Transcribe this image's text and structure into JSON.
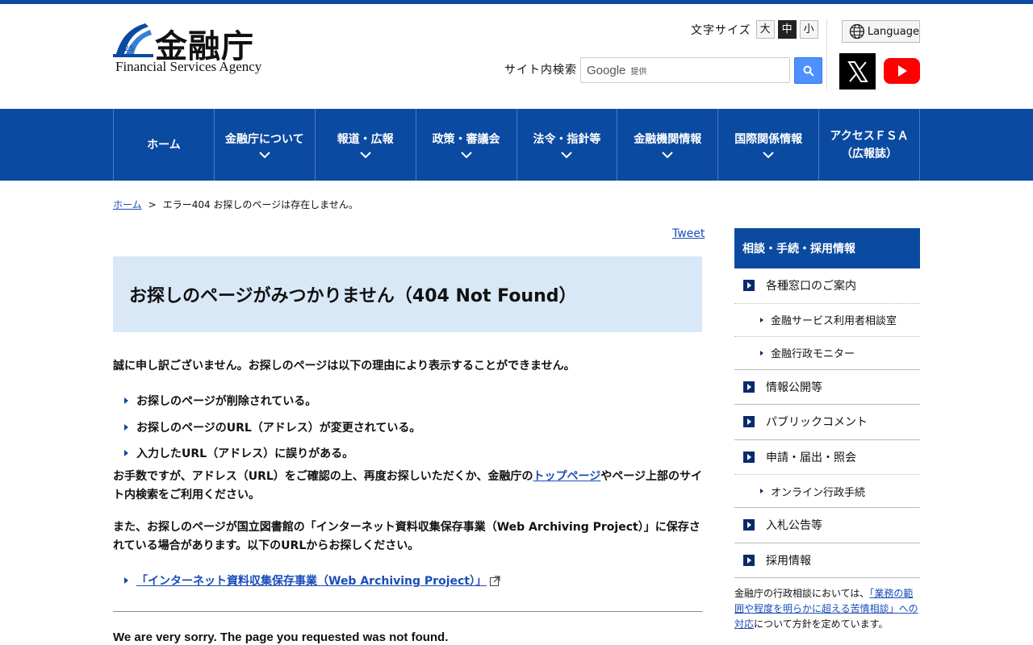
{
  "header": {
    "logo_kanji": "金融庁",
    "logo_en": "Financial Services Agency",
    "font_size_label": "文字サイズ",
    "font_sizes": [
      "大",
      "中",
      "小"
    ],
    "language_label": "Language",
    "search_label": "サイト内検索",
    "search_brand": "Google",
    "search_provided": "提供"
  },
  "nav": {
    "items": [
      {
        "label": "ホーム"
      },
      {
        "label": "金融庁について"
      },
      {
        "label": "報道・広報"
      },
      {
        "label": "政策・審議会"
      },
      {
        "label": "法令・指針等"
      },
      {
        "label": "金融機関情報"
      },
      {
        "label": "国際関係情報"
      },
      {
        "label": "アクセスＦＳＡ",
        "label2": "（広報誌）"
      }
    ]
  },
  "breadcrumb": {
    "home": "ホーム",
    "separator": ">",
    "current": "エラー404 お探しのページは存在しません。"
  },
  "main": {
    "tweet": "Tweet",
    "title": "お探しのページがみつかりません（404 Not Found）",
    "intro": "誠に申し訳ございません。お探しのページは以下の理由により表示することができません。",
    "reasons": [
      "お探しのページが削除されている。",
      "お探しのページのURL（アドレス）が変更されている。",
      "入力したURL（アドレス）に誤りがある。"
    ],
    "p2_before": "お手数ですが、アドレス（URL）をご確認の上、再度お探しいただくか、金融庁の",
    "p2_link": "トップページ",
    "p2_after": "やページ上部のサイト内検索をご利用ください。",
    "p3": "また、お探しのページが国立図書館の「インターネット資料収集保存事業（Web Archiving Project）」に保存されている場合があります。以下のURLからお探しください。",
    "archive_link": "「インターネット資料収集保存事業（Web Archiving Project）」",
    "english_sorry": "We are very sorry. The page you requested was not found."
  },
  "sidebar": {
    "heading": "相談・手続・採用情報",
    "items": [
      {
        "label": "各種窓口のご案内"
      },
      {
        "label": "金融サービス利用者相談室"
      },
      {
        "label": "金融行政モニター"
      },
      {
        "label": "情報公開等"
      },
      {
        "label": "パブリックコメント"
      },
      {
        "label": "申請・届出・照会"
      },
      {
        "label": "オンライン行政手続"
      },
      {
        "label": "入札公告等"
      },
      {
        "label": "採用情報"
      }
    ],
    "note_before": "金融庁の行政相談においては、",
    "note_link": "「業務の範囲や程度を明らかに超える苦情相談」への対応",
    "note_after": "について方針を定めています。"
  },
  "colors": {
    "brand_blue": "#0b4aa1",
    "title_bg": "#d9e8f7",
    "link": "#1a4db8"
  }
}
